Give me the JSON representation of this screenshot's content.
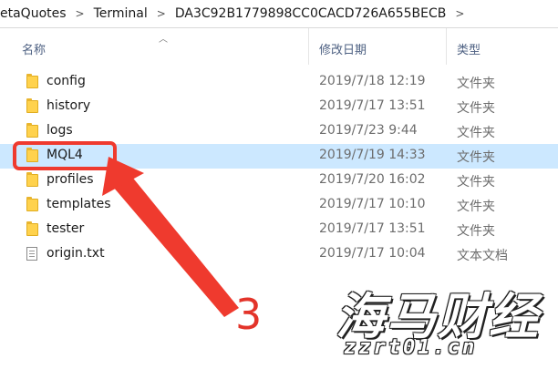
{
  "breadcrumb": {
    "items": [
      "etaQuotes",
      "Terminal",
      "DA3C92B1779898CC0CACD726A655BECB"
    ],
    "separator": ">"
  },
  "columns": {
    "name": "名称",
    "date": "修改日期",
    "type": "类型"
  },
  "rows": [
    {
      "name": "config",
      "date": "2019/7/18 12:19",
      "type": "文件夹",
      "icon": "folder-icon"
    },
    {
      "name": "history",
      "date": "2019/7/17 13:51",
      "type": "文件夹",
      "icon": "folder-icon"
    },
    {
      "name": "logs",
      "date": "2019/7/23 9:44",
      "type": "文件夹",
      "icon": "folder-icon"
    },
    {
      "name": "MQL4",
      "date": "2019/7/19 14:33",
      "type": "文件夹",
      "icon": "folder-icon",
      "selected": true
    },
    {
      "name": "profiles",
      "date": "2019/7/20 16:02",
      "type": "文件夹",
      "icon": "folder-icon"
    },
    {
      "name": "templates",
      "date": "2019/7/17 10:10",
      "type": "文件夹",
      "icon": "folder-icon"
    },
    {
      "name": "tester",
      "date": "2019/7/17 13:51",
      "type": "文件夹",
      "icon": "folder-icon"
    },
    {
      "name": "origin.txt",
      "date": "2019/7/17 10:04",
      "type": "文本文档",
      "icon": "file-icon"
    }
  ],
  "annotation": {
    "step_number": "3",
    "color": "#ef3a2e"
  },
  "watermark": {
    "text": "海马财经",
    "url": "zzrt01.cn"
  },
  "colors": {
    "selection": "#cce8ff",
    "header_text": "#4d6082",
    "folder": "#ffd24d"
  }
}
